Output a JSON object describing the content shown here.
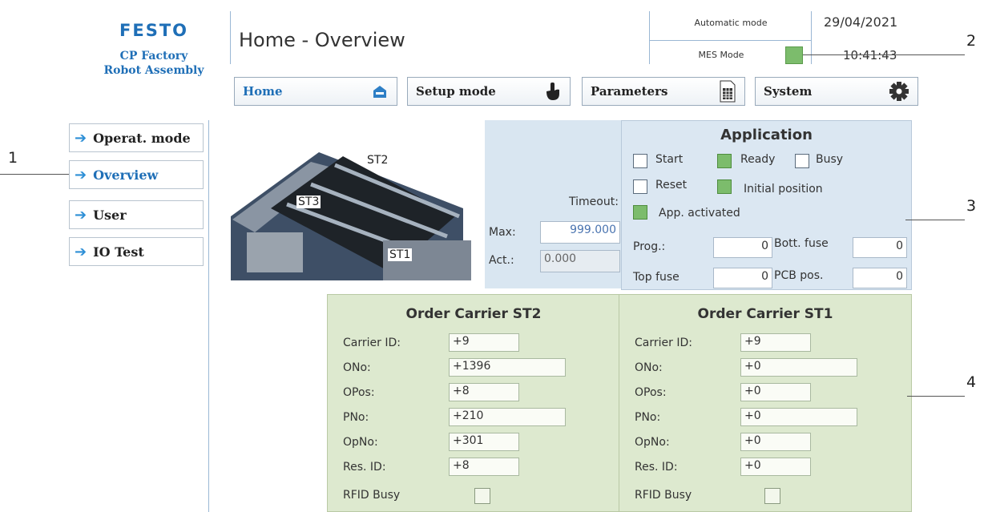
{
  "logo": {
    "brand": "FESTO",
    "line1": "CP Factory",
    "line2": "Robot Assembly"
  },
  "header": {
    "title": "Home - Overview",
    "mode": "Automatic mode",
    "mes_mode": "MES Mode",
    "date": "29/04/2021",
    "time": "10:41:43",
    "mes_led_color": "#7cbc6c"
  },
  "nav": [
    {
      "label": "Home",
      "icon": "home-icon"
    },
    {
      "label": "Setup mode",
      "icon": "hand-pointer-icon"
    },
    {
      "label": "Parameters",
      "icon": "document-grid-icon"
    },
    {
      "label": "System",
      "icon": "gear-icon"
    }
  ],
  "sidebar": [
    {
      "label": "Operat. mode"
    },
    {
      "label": "Overview"
    },
    {
      "label": "User"
    },
    {
      "label": "IO Test"
    }
  ],
  "callouts": [
    "1",
    "2",
    "3",
    "4"
  ],
  "machine": {
    "labels": [
      "ST2",
      "ST3",
      "ST1"
    ]
  },
  "timeout": {
    "label": "Timeout:",
    "max_label": "Max:",
    "max_value": "999.000",
    "act_label": "Act.:",
    "act_value": "0.000"
  },
  "application": {
    "title": "Application",
    "start": "Start",
    "ready": "Ready",
    "busy": "Busy",
    "reset": "Reset",
    "initial": "Initial position",
    "activated": "App. activated",
    "prog_label": "Prog.:",
    "prog_value": "0",
    "bott_label": "Bott. fuse",
    "bott_value": "0",
    "top_label": "Top fuse",
    "top_value": "0",
    "pcb_label": "PCB pos.",
    "pcb_value": "0"
  },
  "orders": [
    {
      "title": "Order Carrier ST2",
      "carrier_label": "Carrier ID:",
      "carrier": "+9",
      "ono_label": "ONo:",
      "ono": "+1396",
      "opos_label": "OPos:",
      "opos": "+8",
      "pno_label": "PNo:",
      "pno": "+210",
      "opno_label": "OpNo:",
      "opno": "+301",
      "resid_label": "Res. ID:",
      "resid": "+8",
      "rfid_label": "RFID Busy"
    },
    {
      "title": "Order Carrier ST1",
      "carrier_label": "Carrier ID:",
      "carrier": "+9",
      "ono_label": "ONo:",
      "ono": "+0",
      "opos_label": "OPos:",
      "opos": "+0",
      "pno_label": "PNo:",
      "pno": "+0",
      "opno_label": "OpNo:",
      "opno": "+0",
      "resid_label": "Res. ID:",
      "resid": "+0",
      "rfid_label": "RFID Busy"
    }
  ]
}
